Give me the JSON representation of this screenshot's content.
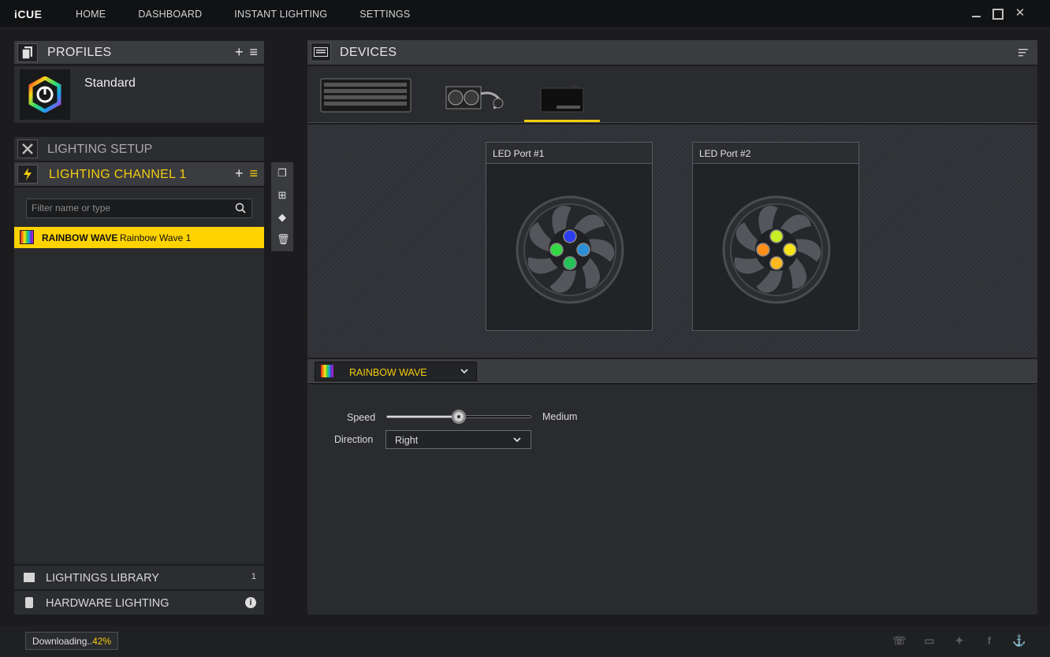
{
  "app": {
    "logo": "iCUE"
  },
  "nav": [
    "HOME",
    "DASHBOARD",
    "INSTANT LIGHTING",
    "SETTINGS"
  ],
  "profiles": {
    "title": "PROFILES",
    "current_profile": "Standard"
  },
  "lighting_setup": {
    "title": "LIGHTING SETUP"
  },
  "channel": {
    "title": "LIGHTING CHANNEL 1",
    "filter_placeholder": "Filter name or type",
    "effects": [
      {
        "type": "RAINBOW WAVE",
        "name": "Rainbow Wave 1"
      }
    ]
  },
  "library": {
    "title": "LIGHTINGS LIBRARY",
    "count": "1"
  },
  "hardware": {
    "title": "HARDWARE LIGHTING"
  },
  "devices": {
    "title": "DEVICES",
    "thumbnails": [
      "keyboard",
      "liquid-cooler",
      "lighting-node"
    ],
    "active_index": 2,
    "ports": [
      {
        "title": "LED Port #1",
        "leds": [
          "#2c3ef0",
          "#33d844",
          "#2b8fd8",
          "#25c25a"
        ]
      },
      {
        "title": "LED Port #2",
        "leds": [
          "#c8ee24",
          "#ff8f1a",
          "#f8e31a",
          "#ffb81e"
        ]
      }
    ]
  },
  "effect": {
    "selected": "RAINBOW WAVE",
    "speed_label": "Speed",
    "speed_value": "Medium",
    "speed_fraction": 0.5,
    "direction_label": "Direction",
    "direction_value": "Right"
  },
  "status": {
    "download_prefix": "Downloading..",
    "download_pct": "42%"
  },
  "colors": {
    "accent": "#f2cc0c",
    "highlight_row": "#ffd300"
  }
}
